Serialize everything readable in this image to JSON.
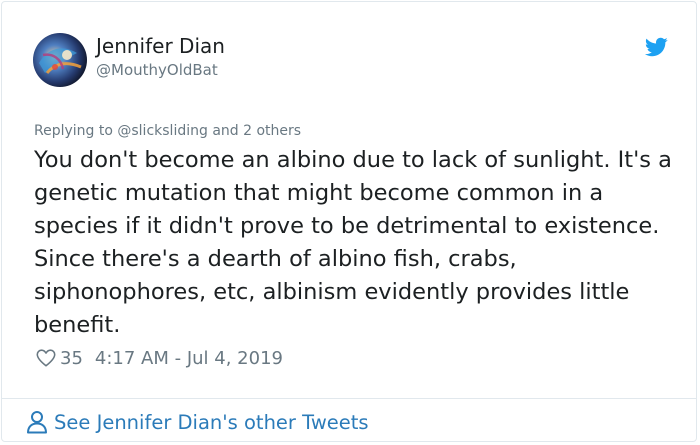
{
  "author": {
    "display_name": "Jennifer Dian",
    "handle": "@MouthyOldBat"
  },
  "reply_context": "Replying to @slicksliding and 2 others",
  "tweet": {
    "text": "You don't become an albino due to lack of sunlight. It's a genetic mutation that might become common in a species if it didn't prove to be detrimental to existence.   Since there's a dearth of albino fish, crabs, siphonophores, etc, albinism evidently provides little benefit."
  },
  "stats": {
    "likes": "35",
    "timestamp": "4:17 AM - Jul 4, 2019"
  },
  "footer": {
    "see_more": "See Jennifer Dian's other Tweets"
  },
  "icons": {
    "brand": "twitter-bird-icon",
    "like": "heart-icon",
    "profile": "person-icon"
  },
  "colors": {
    "twitter_blue": "#1da1f2",
    "link_blue": "#2b7bb9",
    "muted_text": "#697882",
    "border": "#e1e8ed"
  }
}
